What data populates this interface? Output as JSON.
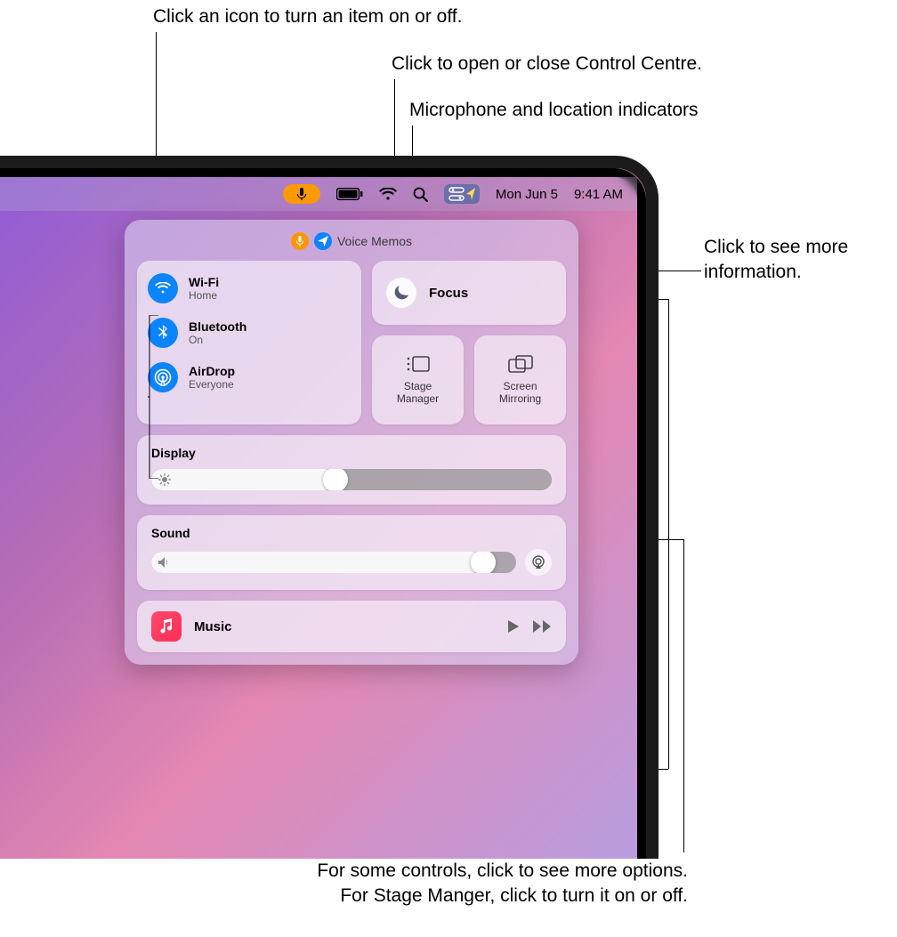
{
  "callouts": {
    "toggle": "Click an icon to turn an item on or off.",
    "open_cc": "Click to open or close Control Centre.",
    "indicators": "Microphone and location indicators",
    "more_info": "Click to see more\ninformation.",
    "more_options": "For some controls, click to see more options.\nFor Stage Manger, click to turn it on or off."
  },
  "menubar": {
    "date": "Mon Jun 5",
    "time": "9:41 AM"
  },
  "voice_row": {
    "app": "Voice Memos"
  },
  "connectivity": {
    "wifi": {
      "title": "Wi-Fi",
      "subtitle": "Home"
    },
    "bluetooth": {
      "title": "Bluetooth",
      "subtitle": "On"
    },
    "airdrop": {
      "title": "AirDrop",
      "subtitle": "Everyone"
    }
  },
  "focus": {
    "label": "Focus"
  },
  "stage_manager": {
    "label": "Stage\nManager"
  },
  "screen_mirroring": {
    "label": "Screen\nMirroring"
  },
  "display": {
    "label": "Display",
    "percent": 46
  },
  "sound": {
    "label": "Sound",
    "percent": 91
  },
  "music": {
    "label": "Music"
  }
}
